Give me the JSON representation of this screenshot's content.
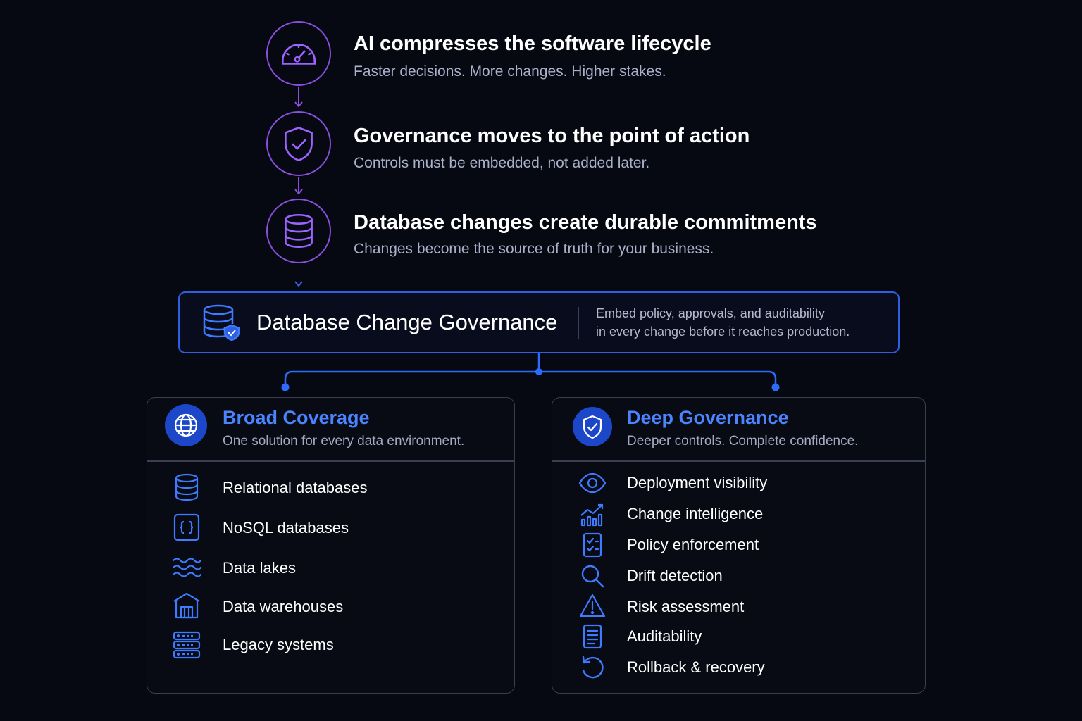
{
  "steps": [
    {
      "title": "AI compresses the software lifecycle",
      "subtitle": "Faster decisions. More changes. Higher stakes.",
      "icon": "speedometer-icon"
    },
    {
      "title": "Governance moves to the point of action",
      "subtitle": "Controls must be embedded, not added later.",
      "icon": "shield-check-icon"
    },
    {
      "title": "Database changes create durable commitments",
      "subtitle": "Changes become the source of truth for your business.",
      "icon": "database-icon"
    }
  ],
  "governance": {
    "title": "Database Change Governance",
    "desc_line1": "Embed policy, approvals, and auditability",
    "desc_line2": "in every change before it reaches production.",
    "icon": "database-shield-icon"
  },
  "broad": {
    "title": "Broad Coverage",
    "subtitle": "One solution for every data environment.",
    "icon": "globe-icon",
    "items": [
      {
        "label": "Relational databases",
        "icon": "database-icon"
      },
      {
        "label": "NoSQL databases",
        "icon": "braces-icon"
      },
      {
        "label": "Data lakes",
        "icon": "waves-icon"
      },
      {
        "label": "Data warehouses",
        "icon": "warehouse-icon"
      },
      {
        "label": "Legacy systems",
        "icon": "server-icon"
      }
    ]
  },
  "deep": {
    "title": "Deep Governance",
    "subtitle": "Deeper controls. Complete confidence.",
    "icon": "shield-check-icon",
    "items": [
      {
        "label": "Deployment visibility",
        "icon": "eye-icon"
      },
      {
        "label": "Change intelligence",
        "icon": "chart-trend-icon"
      },
      {
        "label": "Policy enforcement",
        "icon": "checklist-icon"
      },
      {
        "label": "Drift detection",
        "icon": "magnifier-icon"
      },
      {
        "label": "Risk assessment",
        "icon": "warning-icon"
      },
      {
        "label": "Auditability",
        "icon": "document-icon"
      },
      {
        "label": "Rollback & recovery",
        "icon": "rollback-icon"
      }
    ]
  },
  "colors": {
    "purple": "#8a4fe0",
    "blue": "#2d5fe0",
    "accent_text": "#4a84ff",
    "background": "#070912"
  }
}
